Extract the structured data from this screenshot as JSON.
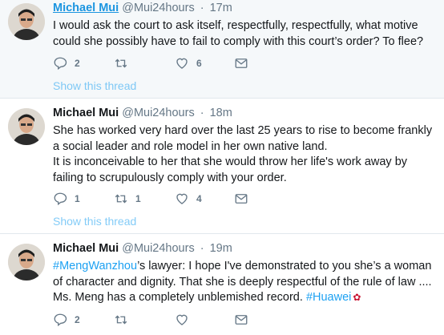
{
  "tweets": [
    {
      "name": "Michael Mui",
      "handle": "@Mui24hours",
      "time": "17m",
      "text_lines": [
        "I would ask the court to ask itself, respectfully, respectfully, what motive could she possibly have to fail to comply with this court’s order? To flee?"
      ],
      "reply_count": "2",
      "retweet_count": "",
      "like_count": "6",
      "show_thread": "Show this thread"
    },
    {
      "name": "Michael Mui",
      "handle": "@Mui24hours",
      "time": "18m",
      "text_lines": [
        "She has worked very hard over the last 25 years to rise to become frankly a social leader and role model in her own native land.",
        "It is inconceivable to her that she would throw her life's work away by failing to scrupulously comply with your order."
      ],
      "reply_count": "1",
      "retweet_count": "1",
      "like_count": "4",
      "show_thread": "Show this thread"
    },
    {
      "name": "Michael Mui",
      "handle": "@Mui24hours",
      "time": "19m",
      "hashtag1": "#MengWanzhou",
      "text_after_hashtag": "’s lawyer:  I hope I've demonstrated to you she’s a woman of character and dignity. That she is deeply respectful of the rule of law .... Ms. Meng has a completely unblemished record.",
      "hashtag2": "#Huawei",
      "reply_count": "2",
      "retweet_count": "",
      "like_count": ""
    }
  ],
  "separator": "·",
  "icons": [
    "reply-icon",
    "retweet-icon",
    "like-icon",
    "message-icon"
  ],
  "colors": {
    "link": "#1da1f2",
    "muted": "#657786",
    "name_link": "#1b95e0",
    "first_bg": "#f5f8fa"
  }
}
